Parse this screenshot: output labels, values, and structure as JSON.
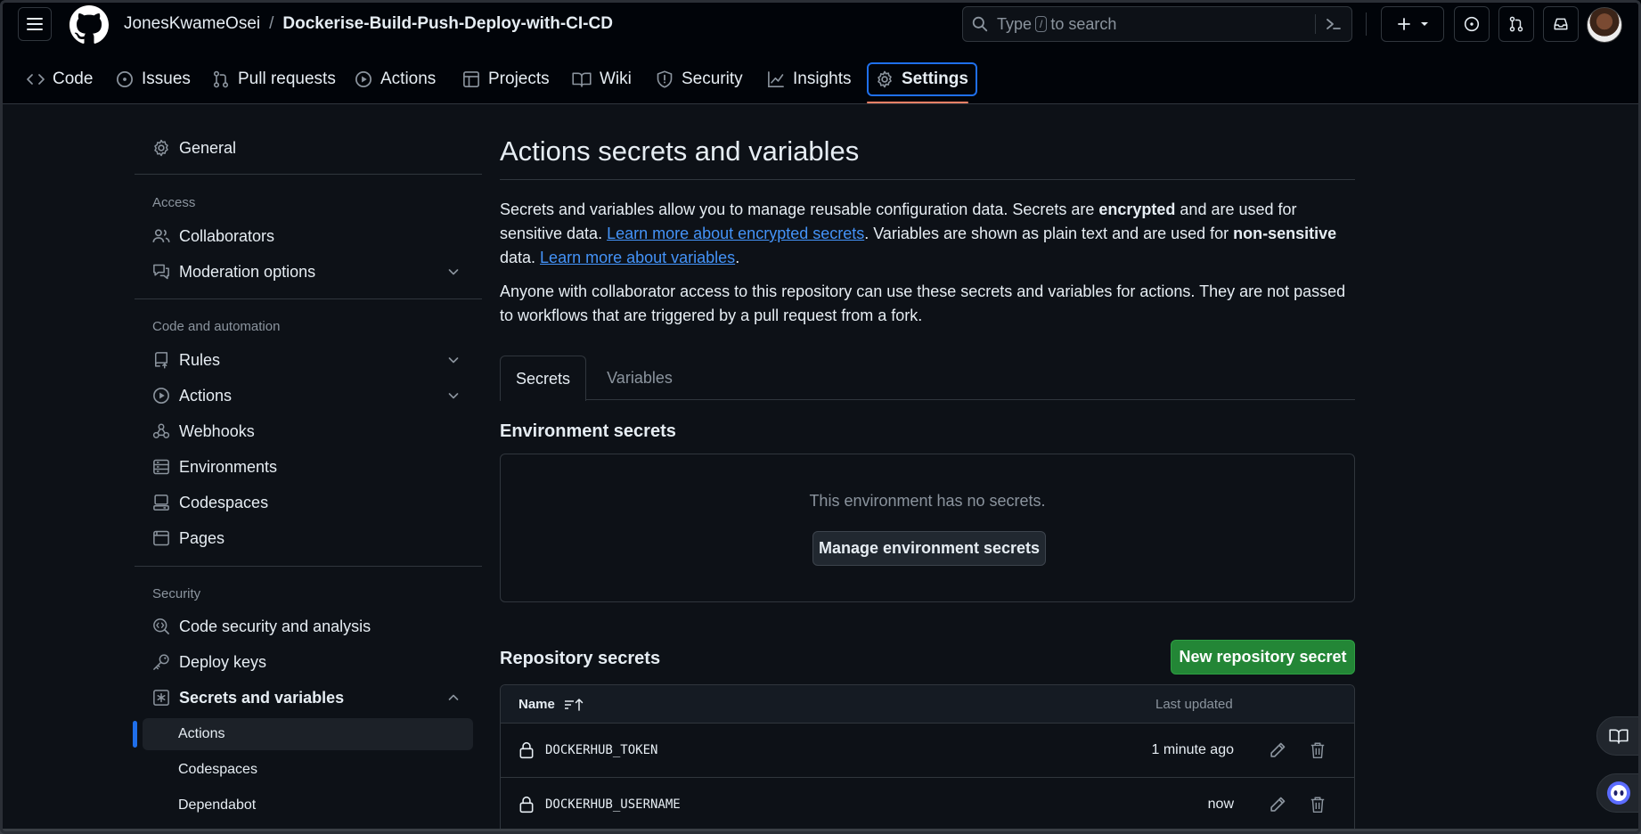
{
  "header": {
    "owner": "JonesKwameOsei",
    "separator": "/",
    "repo": "Dockerise-Build-Push-Deploy-with-CI-CD",
    "search_prefix": "Type",
    "search_key": "/",
    "search_suffix": "to search"
  },
  "repo_tabs": [
    {
      "label": "Code",
      "icon": "code-icon"
    },
    {
      "label": "Issues",
      "icon": "issue-icon"
    },
    {
      "label": "Pull requests",
      "icon": "pull-request-icon"
    },
    {
      "label": "Actions",
      "icon": "play-icon"
    },
    {
      "label": "Projects",
      "icon": "table-icon"
    },
    {
      "label": "Wiki",
      "icon": "book-icon"
    },
    {
      "label": "Security",
      "icon": "shield-icon"
    },
    {
      "label": "Insights",
      "icon": "graph-icon"
    },
    {
      "label": "Settings",
      "icon": "gear-icon",
      "active": true
    }
  ],
  "sidebar": {
    "general": "General",
    "access_heading": "Access",
    "collaborators": "Collaborators",
    "moderation": "Moderation options",
    "code_heading": "Code and automation",
    "rules": "Rules",
    "actions": "Actions",
    "webhooks": "Webhooks",
    "environments": "Environments",
    "codespaces": "Codespaces",
    "pages": "Pages",
    "security_heading": "Security",
    "code_security": "Code security and analysis",
    "deploy_keys": "Deploy keys",
    "secrets_vars": "Secrets and variables",
    "sub_actions": "Actions",
    "sub_codespaces": "Codespaces",
    "sub_dependabot": "Dependabot"
  },
  "main": {
    "title": "Actions secrets and variables",
    "p1_a": "Secrets and variables allow you to manage reusable configuration data. Secrets are ",
    "p1_b": "encrypted",
    "p1_c": " and are used for sensitive data. ",
    "p1_link1": "Learn more about encrypted secrets",
    "p1_d": ". Variables are shown as plain text and are used for ",
    "p1_e": "non-sensitive",
    "p1_f": " data. ",
    "p1_link2": "Learn more about variables",
    "p1_g": ".",
    "p2": "Anyone with collaborator access to this repository can use these secrets and variables for actions. They are not passed to workflows that are triggered by a pull request from a fork.",
    "tab_secrets": "Secrets",
    "tab_variables": "Variables",
    "env_heading": "Environment secrets",
    "env_empty": "This environment has no secrets.",
    "env_button": "Manage environment secrets",
    "repo_heading": "Repository secrets",
    "new_secret_button": "New repository secret",
    "col_name": "Name",
    "col_updated": "Last updated",
    "secrets": [
      {
        "name": "DOCKERHUB_TOKEN",
        "updated": "1 minute ago"
      },
      {
        "name": "DOCKERHUB_USERNAME",
        "updated": "now"
      }
    ]
  }
}
